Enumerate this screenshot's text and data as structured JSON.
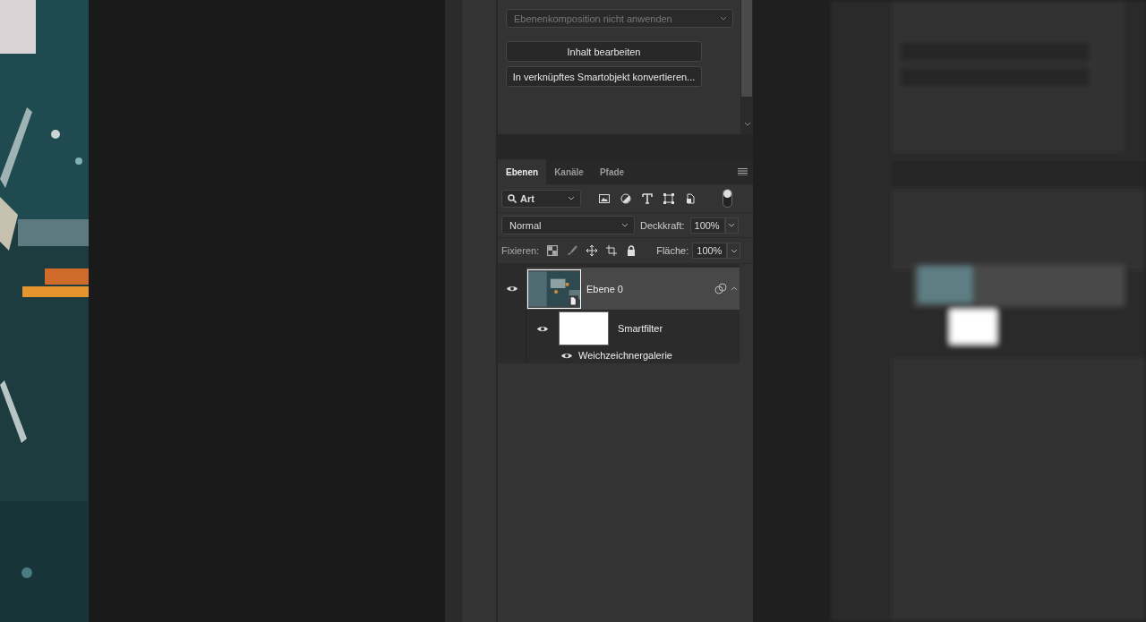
{
  "properties": {
    "layer_comp": {
      "value": "Ebenenkomposition nicht anwenden",
      "disabled": true
    },
    "buttons": [
      "Inhalt bearbeiten",
      "In verknüpftes Smartobjekt konvertieren..."
    ]
  },
  "tabs": [
    {
      "label": "Ebenen",
      "selected": true
    },
    {
      "label": "Kanäle",
      "selected": false
    },
    {
      "label": "Pfade",
      "selected": false
    }
  ],
  "filter": {
    "value": "Art",
    "toggle_on": true
  },
  "blend_mode": "Normal",
  "opacity": {
    "label": "Deckkraft:",
    "value": "100%"
  },
  "lock": {
    "label": "Fixieren:"
  },
  "fill": {
    "label": "Fläche:",
    "value": "100%"
  },
  "layers": [
    {
      "name": "Ebene 0",
      "visible": true,
      "selected": true,
      "smart_filters": {
        "label": "Smartfilter",
        "visible": true,
        "filters": [
          {
            "name": "Weichzeichnergalerie",
            "visible": true
          }
        ]
      }
    }
  ]
}
